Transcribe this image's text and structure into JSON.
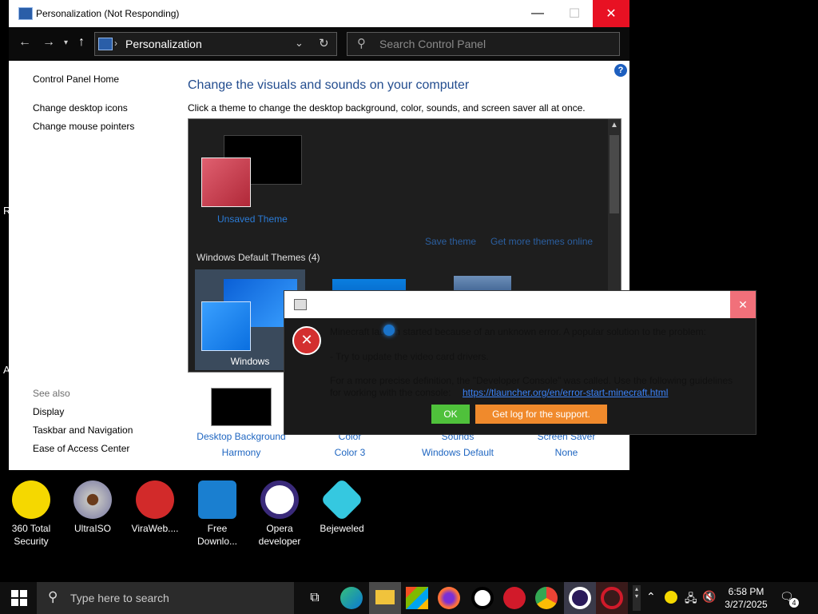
{
  "window": {
    "title": "Personalization (Not Responding)",
    "minimize": "—",
    "maximize": "☐",
    "close": "✕",
    "address": "Personalization",
    "search_placeholder": "Search Control Panel"
  },
  "left_pane": {
    "home": "Control Panel Home",
    "links": [
      "Change desktop icons",
      "Change mouse pointers"
    ],
    "see_also_label": "See also",
    "see_also": [
      "Display",
      "Taskbar and Navigation",
      "Ease of Access Center"
    ]
  },
  "main": {
    "heading": "Change the visuals and sounds on your computer",
    "subtext": "Click a theme to change the desktop background, color, sounds, and screen saver all at once.",
    "unsaved_theme": "Unsaved Theme",
    "save_theme": "Save theme",
    "get_more": "Get more themes online",
    "default_themes": "Windows Default Themes (4)",
    "windows_theme": "Windows",
    "bottom": [
      {
        "label": "Desktop Background",
        "value": "Harmony"
      },
      {
        "label": "Color",
        "value": "Color 3"
      },
      {
        "label": "Sounds",
        "value": "Windows Default"
      },
      {
        "label": "Screen Saver",
        "value": "None"
      }
    ]
  },
  "dialog": {
    "line1": "Minecraft launch started because of an unknown error. A popular solution to the problem:",
    "line2": "- Try to update the video card drivers.",
    "line3": "For a more precise definition, the \"Developer Console\" was called. Use the following guidelines",
    "line4_prefix": "for working with the console:",
    "link": "https://tlauncher.org/en/error-start-minecraft.html",
    "ok": "OK",
    "log": "Get log for the support.",
    "close": "✕"
  },
  "desktop_icons": [
    {
      "label": "360 Total Security",
      "color": "#f5d800"
    },
    {
      "label": "UltraISO",
      "color": "#b0b0b0"
    },
    {
      "label": "ViraWeb....",
      "color": "#d22a2a"
    },
    {
      "label": "Free Downlo...",
      "color": "#1a7fd0"
    },
    {
      "label": "Opera developer",
      "color": "#3a2a7a"
    },
    {
      "label": "Bejeweled",
      "color": "#35c8e0"
    }
  ],
  "taskbar": {
    "search_placeholder": "Type here to search",
    "time": "6:58 PM",
    "date": "3/27/2025",
    "notifications": "4"
  },
  "colors": {
    "accent": "#0078d7",
    "close_red": "#e81123",
    "ok_green": "#4fc13b",
    "log_orange": "#f08a2c"
  }
}
